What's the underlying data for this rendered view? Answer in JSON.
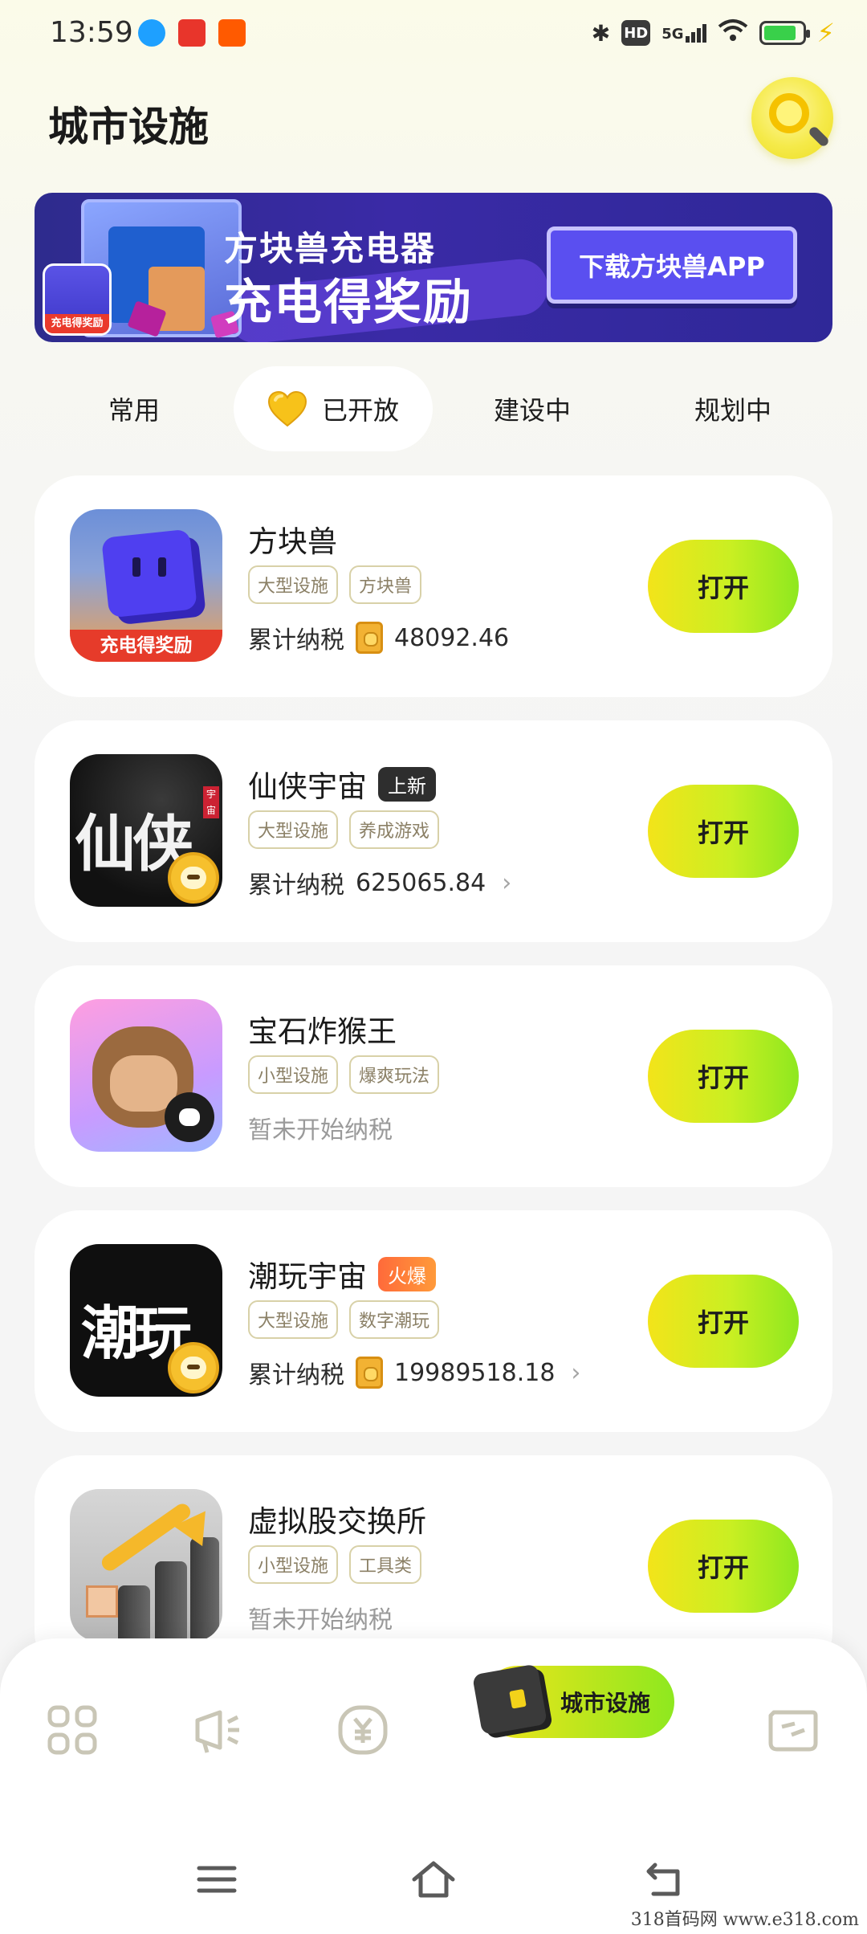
{
  "status_bar": {
    "time": "13:59",
    "left_icons": [
      "qq-icon",
      "toutiao-icon",
      "taobao-icon"
    ],
    "right_icons": [
      "bluetooth-icon",
      "hd-icon",
      "signal-5g-icon",
      "wifi-icon",
      "battery-icon",
      "charging-icon"
    ],
    "hd_label": "HD",
    "network_label": "5G",
    "battery_level": 0.85
  },
  "header": {
    "title": "城市设施",
    "search_icon": "magnifier-icon"
  },
  "banner": {
    "line1": "方块兽充电器",
    "line2": "充电得奖励",
    "cta": "下载方块兽APP",
    "thumb_label": "充电得奖励"
  },
  "tabs": [
    {
      "label": "常用",
      "active": false
    },
    {
      "label": "已开放",
      "active": true,
      "icon": "heart-icon"
    },
    {
      "label": "建设中",
      "active": false
    },
    {
      "label": "规划中",
      "active": false
    }
  ],
  "apps": [
    {
      "name": "方块兽",
      "badge": "",
      "tags": [
        "大型设施",
        "方块兽"
      ],
      "tax_label": "累计纳税",
      "tax_value": "48092.46",
      "has_coin": true,
      "has_chevron": false,
      "button": "打开",
      "icon_caption": "充电得奖励"
    },
    {
      "name": "仙侠宇宙",
      "badge": "上新",
      "tags": [
        "大型设施",
        "养成游戏"
      ],
      "tax_label": "累计纳税",
      "tax_value": "625065.84",
      "has_coin": false,
      "has_chevron": true,
      "button": "打开",
      "icon_caption": "仙侠",
      "icon_seal": "宇宙"
    },
    {
      "name": "宝石炸猴王",
      "badge": "",
      "tags": [
        "小型设施",
        "爆爽玩法"
      ],
      "tax_label": "暂未开始纳税",
      "tax_value": "",
      "has_coin": false,
      "has_chevron": false,
      "button": "打开"
    },
    {
      "name": "潮玩宇宙",
      "badge": "火爆",
      "tags": [
        "大型设施",
        "数字潮玩"
      ],
      "tax_label": "累计纳税",
      "tax_value": "19989518.18",
      "has_coin": true,
      "has_chevron": true,
      "button": "打开",
      "icon_caption": "潮玩"
    },
    {
      "name": "虚拟股交换所",
      "badge": "",
      "tags": [
        "小型设施",
        "工具类"
      ],
      "tax_label": "暂未开始纳税",
      "tax_value": "",
      "has_coin": false,
      "has_chevron": false,
      "button": "打开"
    }
  ],
  "bottom_nav": {
    "items": [
      "grid-icon",
      "megaphone-icon",
      "yuan-icon",
      "city-facilities",
      "chat-icon"
    ],
    "active_label": "城市设施"
  },
  "system_nav": [
    "menu-icon",
    "home-icon",
    "back-icon"
  ],
  "watermark": "318首码网  www.e318.com"
}
